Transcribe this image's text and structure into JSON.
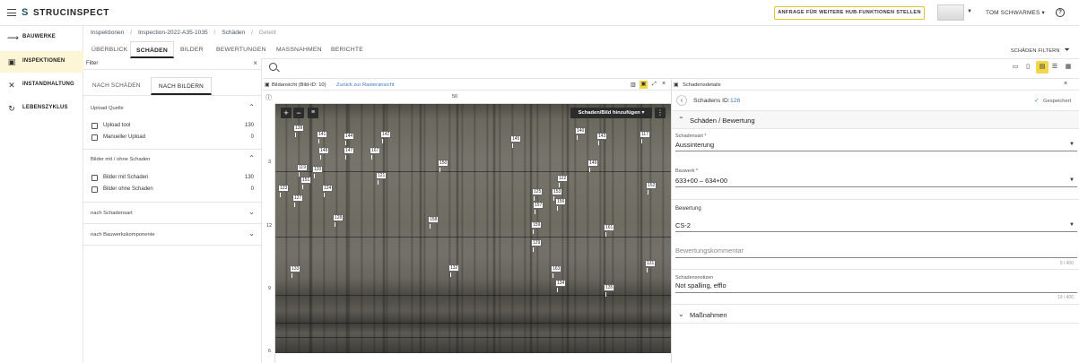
{
  "app": {
    "logo_text": "STRUCINSPECT",
    "logo_mark": "S"
  },
  "topbar": {
    "cta_label": "ANFRAGE FÜR WEITERE HUB-FUNKTIONEN STELLEN",
    "user_label": "TOM SCHWARMES ▾",
    "help_label": "?"
  },
  "nav": {
    "items": [
      {
        "label": "BAUWERKE",
        "icon": "bridge-icon",
        "glyph": "⟿"
      },
      {
        "label": "INSPEKTIONEN",
        "icon": "inspection-icon",
        "glyph": "▣"
      },
      {
        "label": "INSTANDHALTUNG",
        "icon": "tools-icon",
        "glyph": "✕"
      },
      {
        "label": "LEBENSZYKLUS",
        "icon": "refresh-icon",
        "glyph": "↻"
      }
    ],
    "active_index": 1
  },
  "breadcrumb": {
    "items": [
      "Inspektionen",
      "Inspection-2022-A35-1035",
      "Schäden",
      "Geteilt"
    ],
    "separator": "/"
  },
  "tabs": {
    "items": [
      "ÜBERBLICK",
      "SCHÄDEN",
      "BILDER",
      "BEWERTUNGEN",
      "MASSNAHMEN",
      "BERICHTE"
    ],
    "active_index": 1,
    "filter_label": "SCHÄDEN FILTERN"
  },
  "filter_panel": {
    "input_label": "Filter",
    "subtabs": [
      "NACH SCHÄDEN",
      "NACH BILDERN"
    ],
    "active_subtab": 1,
    "sections": [
      {
        "title": "Upload Quelle",
        "expanded": true,
        "options": [
          {
            "label": "Upload tool",
            "count": "130"
          },
          {
            "label": "Manueller Upload",
            "count": "0"
          }
        ]
      },
      {
        "title": "Bilder mit / ohne Schaden",
        "expanded": true,
        "options": [
          {
            "label": "Bilder mit Schaden",
            "count": "130"
          },
          {
            "label": "Bilder ohne Schaden",
            "count": "0"
          }
        ]
      },
      {
        "title": "nach Schadensart",
        "expanded": false,
        "options": []
      },
      {
        "title": "nach Bauwerkskomponente",
        "expanded": false,
        "options": []
      }
    ]
  },
  "image_view": {
    "title": "Bildansicht (Bild-ID: 10)",
    "back_link": "Zurück zur Rasteransicht",
    "ruler_top": [
      "50"
    ],
    "ruler_left": [
      "3",
      "12",
      "9",
      "6"
    ],
    "add_button": "Schaden/Bild hinzufügen ▾",
    "damage_tags": [
      {
        "label": "139"
      },
      {
        "label": "141"
      },
      {
        "label": "144"
      },
      {
        "label": "142"
      },
      {
        "label": "145"
      },
      {
        "label": "140"
      },
      {
        "label": "143"
      },
      {
        "label": "117"
      },
      {
        "label": "148"
      },
      {
        "label": "147"
      },
      {
        "label": "167"
      },
      {
        "label": "150"
      },
      {
        "label": "149"
      },
      {
        "label": "119"
      },
      {
        "label": "120"
      },
      {
        "label": "121"
      },
      {
        "label": "151"
      },
      {
        "label": "122"
      },
      {
        "label": "152"
      },
      {
        "label": "123"
      },
      {
        "label": "124"
      },
      {
        "label": "125"
      },
      {
        "label": "153"
      },
      {
        "label": "127"
      },
      {
        "label": "157"
      },
      {
        "label": "156"
      },
      {
        "label": "128"
      },
      {
        "label": "158"
      },
      {
        "label": "159"
      },
      {
        "label": "161"
      },
      {
        "label": "129"
      },
      {
        "label": "133"
      },
      {
        "label": "132"
      },
      {
        "label": "163"
      },
      {
        "label": "131"
      },
      {
        "label": "134"
      },
      {
        "label": "135"
      }
    ]
  },
  "details": {
    "title": "Schadensdetails",
    "damage_id_label": "Schadens ID:",
    "damage_id_value": "126",
    "saved_label": "Gespeichert",
    "section_title": "Schäden / Bewertung",
    "fields": {
      "schadensart_label": "Schadensart *",
      "schadensart_value": "Aussinterung",
      "bauwerk_label": "Bauwerk *",
      "bauwerk_value": "633+00 – 634+00",
      "bewertung_label": "Bewertung",
      "bewertung_value": "CS-2",
      "kommentar_placeholder": "Bewertungskommentar",
      "kommentar_counter": "0 / 400",
      "notizen_label": "Schadensnotizen",
      "notizen_value": "Not spalling, efflo",
      "notizen_counter": "19 / 400"
    },
    "massnahmen_title": "Maßnahmen"
  }
}
